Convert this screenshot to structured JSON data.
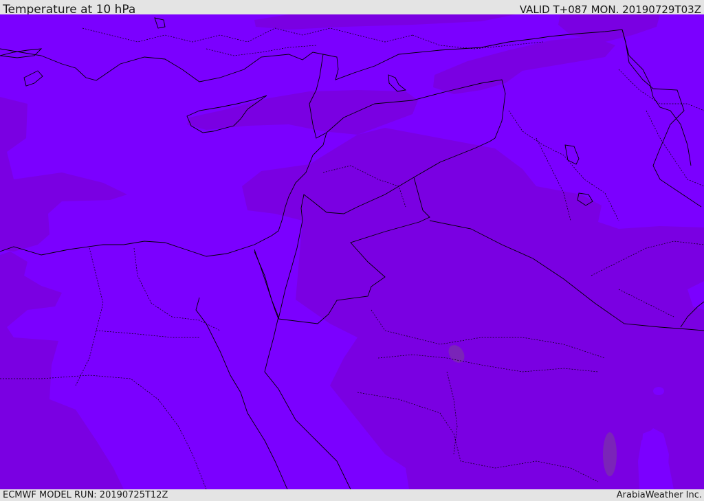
{
  "header": {
    "title": "Temperature at 10 hPa",
    "valid": "VALID T+087 MON. 20190729T03Z"
  },
  "footer": {
    "model_run": "ECMWF MODEL RUN: 20190725T12Z",
    "credit": "ArabiaWeather Inc."
  },
  "map": {
    "colors": {
      "light_band": "#7b00ff",
      "dark_band": "#7a00e2",
      "spot": "#7a24b8",
      "coastline": "#000000",
      "border": "#000000"
    }
  }
}
